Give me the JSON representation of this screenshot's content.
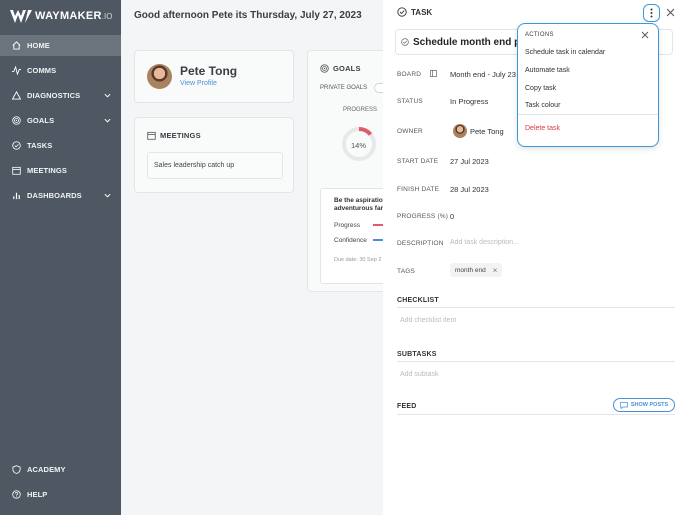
{
  "sidebar": {
    "logo_text": "WAYMAKER",
    "logo_tld": ".IO",
    "items": [
      {
        "label": "HOME",
        "icon": "home-icon"
      },
      {
        "label": "COMMS",
        "icon": "pulse-icon"
      },
      {
        "label": "DIAGNOSTICS",
        "icon": "triangle-icon"
      },
      {
        "label": "GOALS",
        "icon": "target-icon"
      },
      {
        "label": "TASKS",
        "icon": "check-circle-icon"
      },
      {
        "label": "MEETINGS",
        "icon": "calendar-icon"
      },
      {
        "label": "DASHBOARDS",
        "icon": "bar-chart-icon"
      }
    ],
    "bottom_items": [
      {
        "label": "ACADEMY",
        "icon": "shield-icon"
      },
      {
        "label": "HELP",
        "icon": "question-icon"
      }
    ]
  },
  "main": {
    "greeting": "Good afternoon Pete its Thursday, July 27, 2023",
    "profile": {
      "name": "Pete Tong",
      "link": "View Profile"
    },
    "meetings": {
      "title": "MEETINGS",
      "item": "Sales leadership catch up"
    },
    "goals": {
      "title": "GOALS",
      "private_label": "PRIVATE GOALS",
      "progress_label": "PROGRESS",
      "progress_value": "14%",
      "progress_fraction": 0.14,
      "goal_title": "Be the aspiratio adventurous far",
      "progress_row": "Progress",
      "confidence_row": "Confidence",
      "due": "Due date: 30 Sep 2"
    }
  },
  "panel": {
    "header": "TASK",
    "title": "Schedule month end perp m",
    "fields": {
      "board_label": "BOARD",
      "board_value": "Month end - July 23",
      "status_label": "STATUS",
      "status_value": "In Progress",
      "owner_label": "OWNER",
      "owner_value": "Pete Tong",
      "start_label": "START DATE",
      "start_value": "27 Jul 2023",
      "finish_label": "FINISH DATE",
      "finish_value": "28 Jul 2023",
      "progress_label": "PROGRESS (%)",
      "progress_value": "0",
      "description_label": "DESCRIPTION",
      "description_placeholder": "Add task description...",
      "tags_label": "TAGS",
      "tag": "month end"
    },
    "checklist": {
      "title": "CHECKLIST",
      "placeholder": "Add checklist item"
    },
    "subtasks": {
      "title": "SUBTASKS",
      "placeholder": "Add subtask"
    },
    "feed": {
      "title": "FEED",
      "show_posts": "SHOW POSTS"
    }
  },
  "actions_menu": {
    "title": "ACTIONS",
    "items": [
      "Schedule task in calendar",
      "Automate task",
      "Copy task",
      "Task colour"
    ],
    "danger_item": "Delete task"
  },
  "colors": {
    "sidebar": "#4f5862",
    "accent": "#3a9ad9",
    "danger": "#d63a46",
    "progress_ring": "#e05a6a"
  }
}
